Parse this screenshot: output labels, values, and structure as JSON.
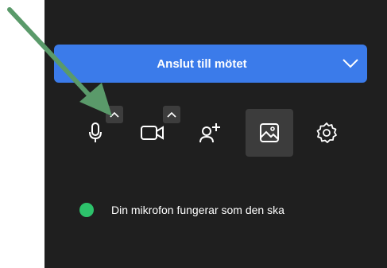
{
  "join_button": {
    "label": "Anslut till mötet"
  },
  "controls": [
    {
      "icon": "microphone-icon"
    },
    {
      "icon": "camera-icon"
    },
    {
      "icon": "add-person-icon"
    },
    {
      "icon": "background-image-icon"
    },
    {
      "icon": "gear-icon"
    }
  ],
  "status": {
    "text": "Din mikrofon fungerar som den ska",
    "color": "#2dc26b"
  },
  "colors": {
    "panel": "#1f1f1f",
    "accent": "#3b7bea",
    "annotation_arrow": "#5a9a6a"
  }
}
